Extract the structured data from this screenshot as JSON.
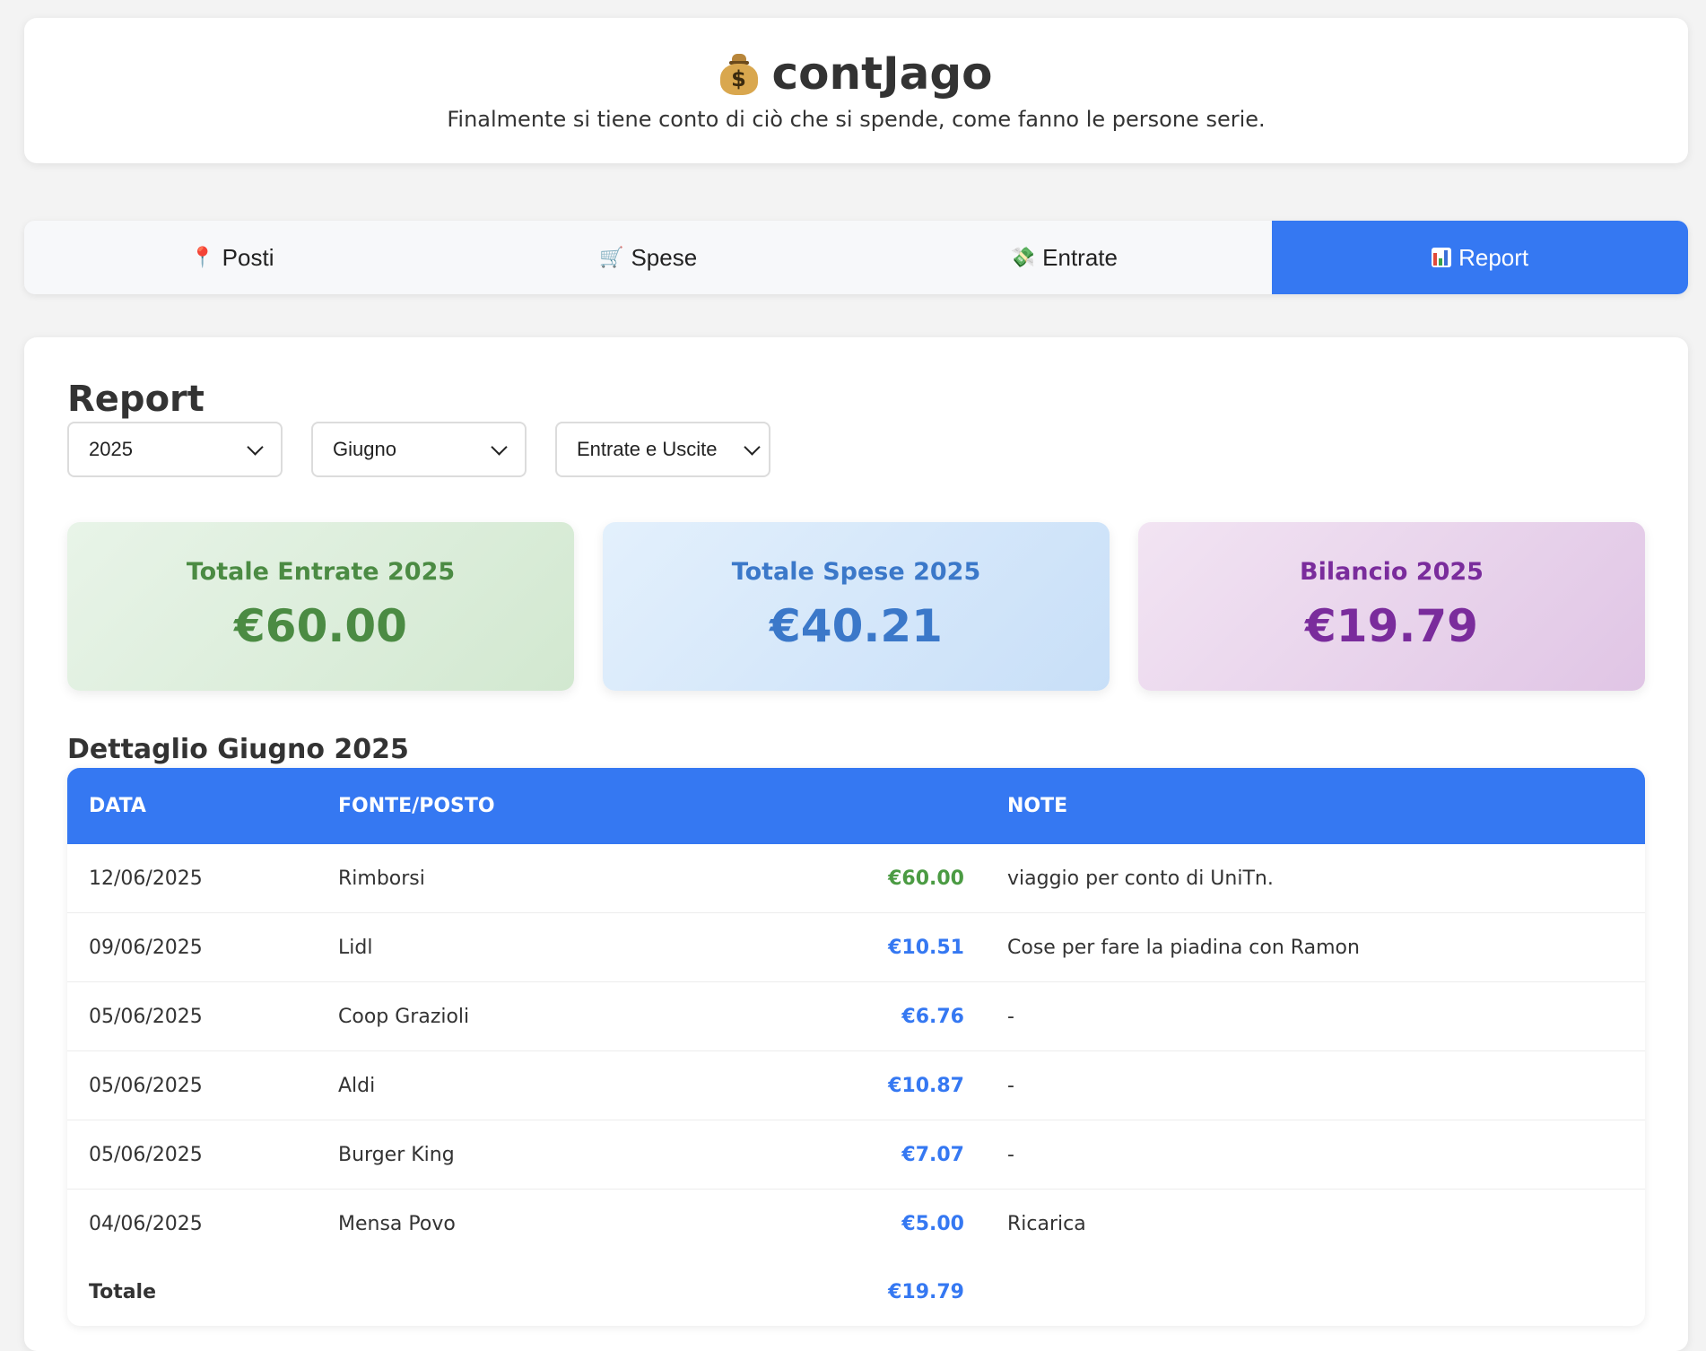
{
  "header": {
    "title": "contJago",
    "icon": "money-bag-icon",
    "subtitle": "Finalmente si tiene conto di ciò che si spende, come fanno le persone serie."
  },
  "tabs": [
    {
      "label": "Posti",
      "icon": "pin-icon",
      "active": false
    },
    {
      "label": "Spese",
      "icon": "cart-icon",
      "active": false
    },
    {
      "label": "Entrate",
      "icon": "money-wings-icon",
      "active": false
    },
    {
      "label": "Report",
      "icon": "bar-chart-icon",
      "active": true
    }
  ],
  "report": {
    "title": "Report",
    "filters": {
      "year": "2025",
      "month": "Giugno",
      "type": "Entrate e Uscite"
    },
    "cards": {
      "income": {
        "label": "Totale Entrate 2025",
        "value": "€60.00",
        "color": "#4b8b43"
      },
      "expenses": {
        "label": "Totale Spese 2025",
        "value": "€40.21",
        "color": "#3b78c9"
      },
      "balance": {
        "label": "Bilancio 2025",
        "value": "€19.79",
        "color": "#7a2c9c"
      }
    },
    "detail_title": "Dettaglio Giugno 2025",
    "table": {
      "headers": {
        "date": "DATA",
        "source": "FONTE/POSTO",
        "amount": "",
        "note": "NOTE"
      },
      "rows": [
        {
          "date": "12/06/2025",
          "source": "Rimborsi",
          "amount": "€60.00",
          "kind": "in",
          "note": "viaggio per conto di UniTn."
        },
        {
          "date": "09/06/2025",
          "source": "Lidl",
          "amount": "€10.51",
          "kind": "out",
          "note": "Cose per fare la piadina con Ramon"
        },
        {
          "date": "05/06/2025",
          "source": "Coop Grazioli",
          "amount": "€6.76",
          "kind": "out",
          "note": "-"
        },
        {
          "date": "05/06/2025",
          "source": "Aldi",
          "amount": "€10.87",
          "kind": "out",
          "note": "-"
        },
        {
          "date": "05/06/2025",
          "source": "Burger King",
          "amount": "€7.07",
          "kind": "out",
          "note": "-"
        },
        {
          "date": "04/06/2025",
          "source": "Mensa Povo",
          "amount": "€5.00",
          "kind": "out",
          "note": "Ricarica"
        }
      ],
      "total": {
        "label": "Totale",
        "amount": "€19.79"
      }
    }
  },
  "colors": {
    "accent": "#3578f2",
    "income": "#4b9b43",
    "expense": "#3578f2"
  }
}
